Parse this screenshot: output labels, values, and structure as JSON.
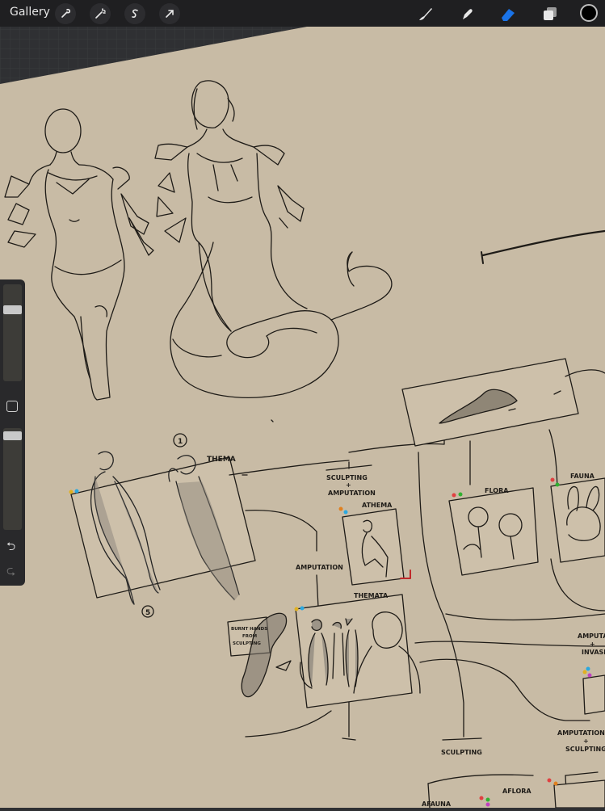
{
  "app": {
    "gallery_label": "Gallery",
    "tools_left": [
      "wrench-icon",
      "magic-wand-icon",
      "selection-s-icon",
      "transform-arrow-icon"
    ],
    "tools_right": [
      "brush-icon",
      "smudge-icon",
      "eraser-icon",
      "layers-icon"
    ],
    "active_tool": "eraser-icon",
    "current_color": "#000000",
    "accent_color": "#1a73e8"
  },
  "sidebar": {
    "brush_size": 0.9,
    "opacity": 0.98
  },
  "canvas": {
    "background": "#c8bba5",
    "labels": {
      "thema": "THEMA",
      "marker_1": "1",
      "marker_5": "5",
      "sculpting_amputation_l1": "SCULPTING",
      "sculpting_amputation_l2": "+",
      "sculpting_amputation_l3": "AMPUTATION",
      "athema": "ATHEMA",
      "amputation": "AMPUTATION",
      "themata": "THEMATA",
      "burnt_l1": "BURNT HANDS",
      "burnt_l2": "FROM",
      "burnt_l3": "SCULPTING",
      "flora": "FLORA",
      "fauna": "FAUNA",
      "amput_invasive_l1": "AMPUTA",
      "amput_invasive_l2": "+",
      "amput_invasive_l3": "INVASI",
      "sculpting": "SCULPTING",
      "amput_sculpt_l1": "AMPUTATION",
      "amput_sculpt_l2": "+",
      "amput_sculpt_l3": "SCULPTING",
      "afauna": "AFAUNA",
      "aflora": "AFLORA"
    }
  }
}
